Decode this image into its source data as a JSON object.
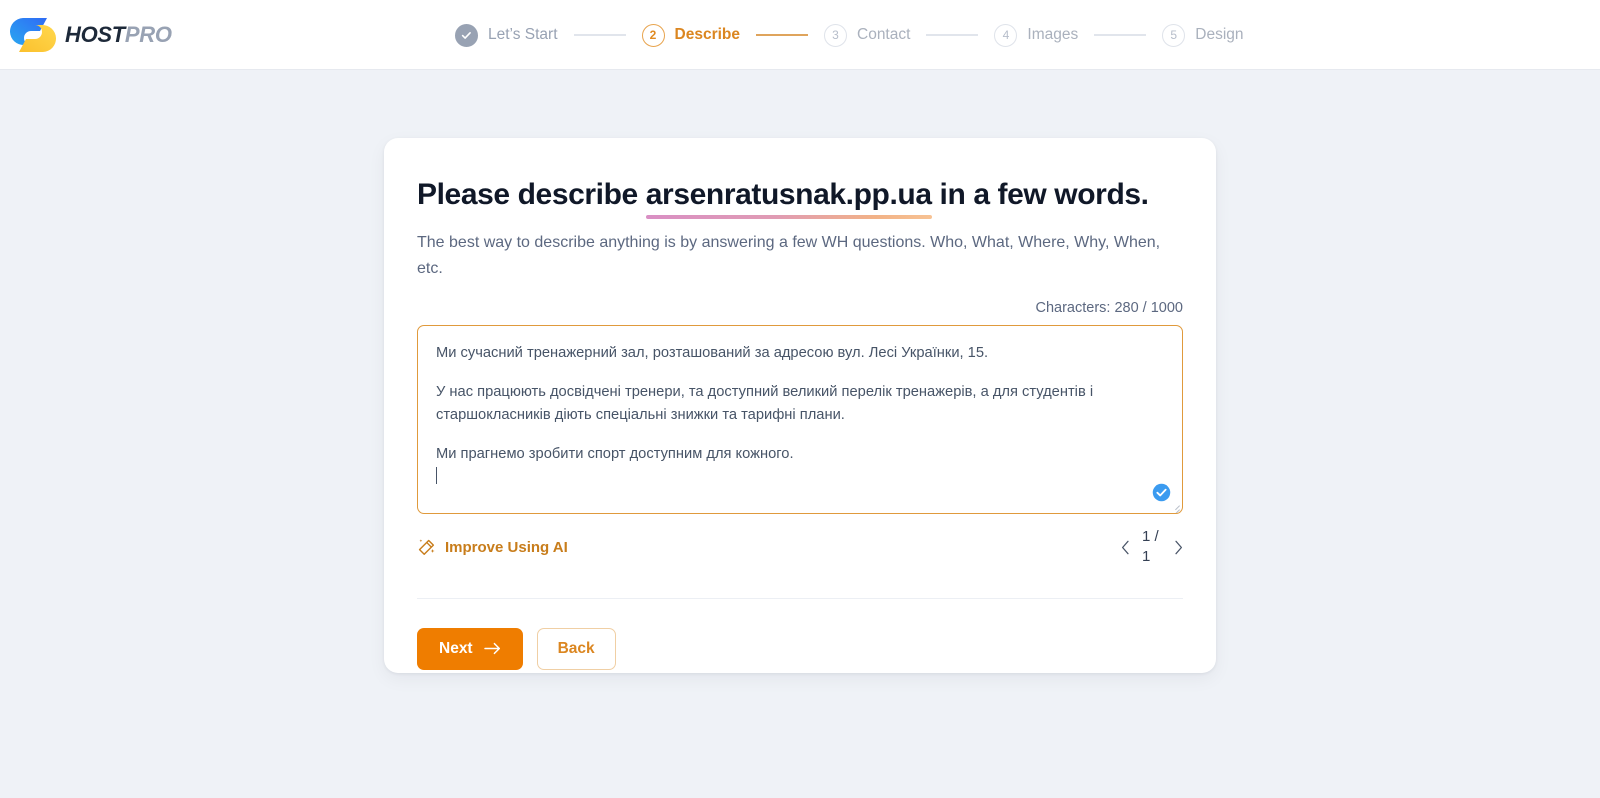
{
  "brand": {
    "name_part_1": "HOST",
    "name_part_2": "PRO",
    "logo_icon": "hostpro-logo-icon"
  },
  "stepper": {
    "steps": [
      {
        "number": "1",
        "label": "Let’s Start",
        "state": "done",
        "marker": "✓"
      },
      {
        "number": "2",
        "label": "Describe",
        "state": "current",
        "marker": "2"
      },
      {
        "number": "3",
        "label": "Contact",
        "state": "todo",
        "marker": "3"
      },
      {
        "number": "4",
        "label": "Images",
        "state": "todo",
        "marker": "4"
      },
      {
        "number": "5",
        "label": "Design",
        "state": "todo",
        "marker": "5"
      }
    ]
  },
  "card": {
    "title_prefix": "Please describe ",
    "title_domain": "arsenratusnak.pp.ua",
    "title_suffix": " in a few words.",
    "subtitle": "The best way to describe anything is by answering a few WH questions. Who, What, Where, Why, When, etc.",
    "counter": "Characters: 280 / 1000",
    "textarea": {
      "paragraphs": [
        "Ми сучасний тренажерний зал, розташований за адресою вул. Лесі Українки, 15.",
        "У нас працюють досвідчені тренери, та доступний великий перелік тренажерів, а для студентів і старшокласників діють спеціальні знижки та тарифні плани.",
        "Ми прагнемо зробити спорт доступним для кожного."
      ],
      "placeholder": "",
      "valid_badge_icon": "check-circle-icon",
      "resize_handle_icon": "resize-handle-icon"
    },
    "ai_link": {
      "label": "Improve Using AI",
      "icon": "magic-wand-icon"
    },
    "pager": {
      "prev_icon": "chevron-left-icon",
      "next_icon": "chevron-right-icon",
      "current": "1 /",
      "total": "1"
    },
    "buttons": {
      "next_label": "Next",
      "next_icon": "arrow-right-icon",
      "back_label": "Back"
    }
  },
  "colors": {
    "accent_orange": "#ef7d00",
    "step_current": "#db8620",
    "textarea_border": "#e09a3c",
    "badge_blue": "#3b9bf0",
    "page_background": "#eff2f7",
    "underline_from": "#d98fc4",
    "underline_to": "#f7c293"
  }
}
